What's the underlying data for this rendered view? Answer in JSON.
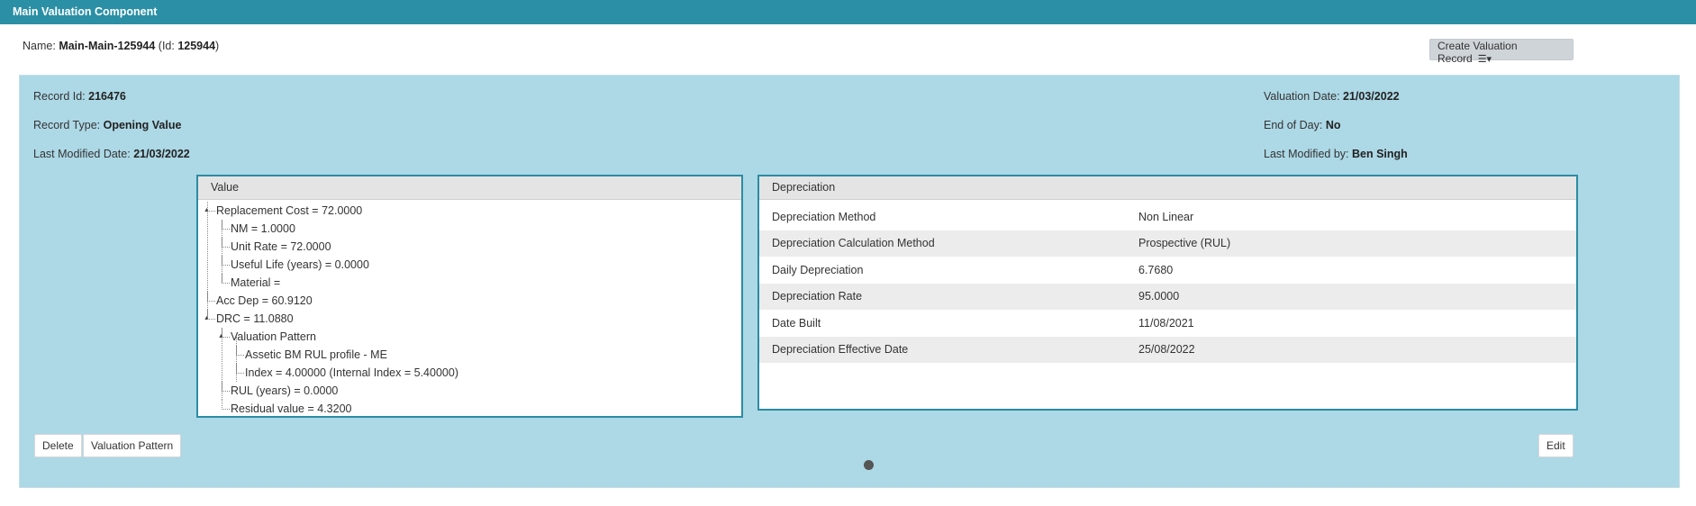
{
  "header": {
    "title": "Main Valuation Component"
  },
  "component": {
    "name_label": "Name:",
    "name_value": "Main-Main-125944",
    "id_prefix": "(Id:",
    "id_value": "125944",
    "id_suffix": ")"
  },
  "toolbar": {
    "create_label": "Create Valuation Record",
    "menu_glyph": "☰▾"
  },
  "record": {
    "left": [
      {
        "label": "Record Id:",
        "value": "216476"
      },
      {
        "label": "Record Type:",
        "value": "Opening Value"
      },
      {
        "label": "Last Modified Date:",
        "value": "21/03/2022"
      }
    ],
    "right": [
      {
        "label": "Valuation Date:",
        "value": "21/03/2022"
      },
      {
        "label": "End of Day:",
        "value": "No"
      },
      {
        "label": "Last Modified by:",
        "value": "Ben Singh"
      }
    ]
  },
  "value_panel": {
    "title": "Value",
    "tree": [
      "Replacement Cost = 72.0000",
      "NM = 1.0000",
      "Unit Rate = 72.0000",
      "Useful Life (years) = 0.0000",
      "Material =",
      "Acc Dep = 60.9120",
      "DRC = 11.0880",
      "Valuation Pattern",
      "Assetic BM RUL profile - ME",
      "Index = 4.00000 (Internal Index = 5.40000)",
      "RUL (years) = 0.0000",
      "Residual value = 4.3200"
    ]
  },
  "depreciation_panel": {
    "title": "Depreciation",
    "rows": [
      {
        "label": "Depreciation Method",
        "value": "Non Linear"
      },
      {
        "label": "Depreciation Calculation Method",
        "value": "Prospective (RUL)"
      },
      {
        "label": "Daily Depreciation",
        "value": "6.7680"
      },
      {
        "label": "Depreciation Rate",
        "value": "95.0000"
      },
      {
        "label": "Date Built",
        "value": "11/08/2021"
      },
      {
        "label": "Depreciation Effective Date",
        "value": "25/08/2022"
      }
    ]
  },
  "actions": {
    "delete_label": "Delete",
    "pattern_label": "Valuation Pattern",
    "edit_label": "Edit"
  },
  "colors": {
    "header": "#2b8fa5",
    "panel": "#add8e6",
    "box_border": "#2a8ca3"
  }
}
